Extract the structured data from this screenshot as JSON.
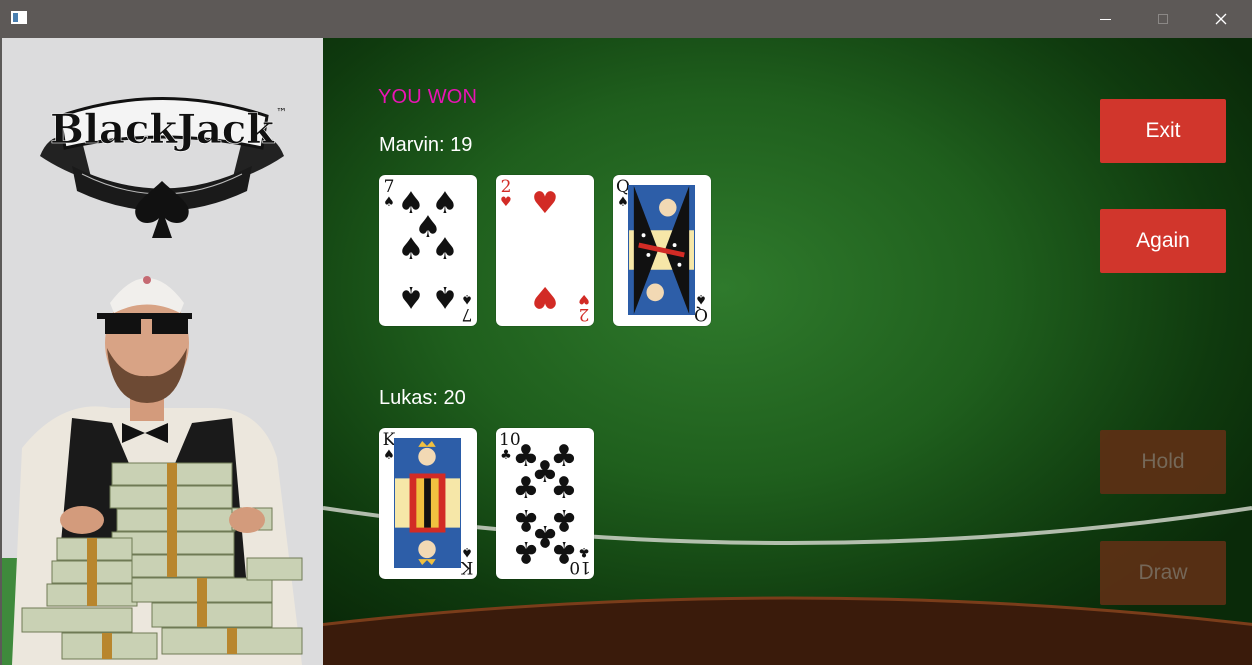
{
  "window": {
    "controls": {
      "minimize": "minimize-icon",
      "maximize": "maximize-icon",
      "close": "close-icon"
    }
  },
  "logo": {
    "text": "BlackJack",
    "trademark": "™"
  },
  "status": {
    "text": "YOU WON",
    "color": "#e814b4"
  },
  "players": [
    {
      "label": "Marvin: 19",
      "cards": [
        {
          "rank": "7",
          "suit": "♠",
          "color": "black"
        },
        {
          "rank": "2",
          "suit": "♥",
          "color": "red"
        },
        {
          "rank": "Q",
          "suit": "♠",
          "color": "black"
        }
      ]
    },
    {
      "label": "Lukas: 20",
      "cards": [
        {
          "rank": "K",
          "suit": "♠",
          "color": "black"
        },
        {
          "rank": "10",
          "suit": "♣",
          "color": "black"
        }
      ]
    }
  ],
  "buttons": {
    "exit": "Exit",
    "again": "Again",
    "hold": "Hold",
    "draw": "Draw"
  },
  "colors": {
    "button_active": "#d1362c",
    "felt": "#1f5f1d"
  }
}
